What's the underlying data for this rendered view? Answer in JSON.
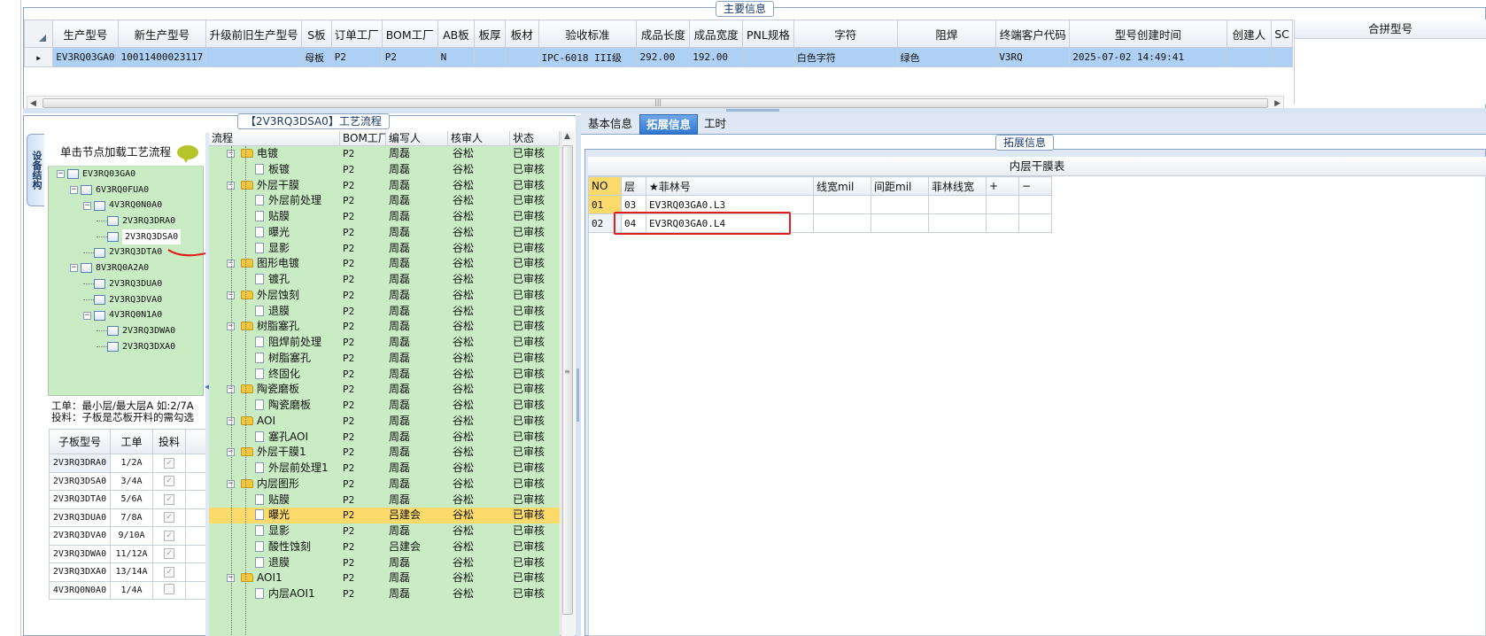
{
  "main_info": {
    "legend": "主要信息",
    "columns": [
      "生产型号",
      "新生产型号",
      "升级前旧生产型号",
      "S板",
      "订单工厂",
      "BOM工厂",
      "AB板",
      "板厚",
      "板材",
      "验收标准",
      "成品长度",
      "成品宽度",
      "PNL规格",
      "字符",
      "阻焊",
      "终端客户代码",
      "型号创建时间",
      "创建人",
      "SC"
    ],
    "rows": [
      [
        "EV3RQ03GA0",
        "10011400023117",
        "",
        "母板",
        "P2",
        "P2",
        "N",
        "",
        "",
        "IPC-6018 III级",
        "292.00",
        "192.00",
        "",
        "白色字符",
        "绿色",
        "V3RQ",
        "2025-07-02 14:49:41",
        "",
        ""
      ]
    ],
    "combo_header": "合拼型号"
  },
  "left": {
    "legend": "【2V3RQ3DSA0】工艺流程",
    "vertical_tab": "设备结构",
    "tree_header": "单击节点加载工艺流程",
    "tree": [
      {
        "label": "EV3RQ03GA0",
        "depth": 0,
        "expander": "−"
      },
      {
        "label": "6V3RQ0FUA0",
        "depth": 1,
        "expander": "−"
      },
      {
        "label": "4V3RQ0N0A0",
        "depth": 2,
        "expander": "−"
      },
      {
        "label": "2V3RQ3DRA0",
        "depth": 3,
        "expander": ""
      },
      {
        "label": "2V3RQ3DSA0",
        "depth": 3,
        "expander": "",
        "selected": true
      },
      {
        "label": "2V3RQ3DTA0",
        "depth": 2,
        "expander": ""
      },
      {
        "label": "8V3RQ0A2A0",
        "depth": 1,
        "expander": "−"
      },
      {
        "label": "2V3RQ3DUA0",
        "depth": 2,
        "expander": ""
      },
      {
        "label": "2V3RQ3DVA0",
        "depth": 2,
        "expander": ""
      },
      {
        "label": "4V3RQ0N1A0",
        "depth": 2,
        "expander": "−"
      },
      {
        "label": "2V3RQ3DWA0",
        "depth": 3,
        "expander": ""
      },
      {
        "label": "2V3RQ3DXA0",
        "depth": 3,
        "expander": ""
      }
    ],
    "note1": "工单：最小层/最大层A 如:2/7A",
    "note2": "投料：子板是芯板开料的需勾选",
    "sub_columns": [
      "子板型号",
      "工单",
      "投料"
    ],
    "sub_rows": [
      [
        "2V3RQ3DRA0",
        "1/2A",
        true
      ],
      [
        "2V3RQ3DSA0",
        "3/4A",
        true
      ],
      [
        "2V3RQ3DTA0",
        "5/6A",
        true
      ],
      [
        "2V3RQ3DUA0",
        "7/8A",
        true
      ],
      [
        "2V3RQ3DVA0",
        "9/10A",
        true
      ],
      [
        "2V3RQ3DWA0",
        "11/12A",
        true
      ],
      [
        "2V3RQ3DXA0",
        "13/14A",
        true
      ],
      [
        "4V3RQ0N0A0",
        "1/4A",
        false
      ]
    ]
  },
  "process": {
    "columns": [
      "流程",
      "BOM工厂",
      "编写人",
      "核审人",
      "状态"
    ],
    "rows": [
      {
        "name": "电镀",
        "type": "folder",
        "bom": "P2",
        "writer": "周磊",
        "reviewer": "谷松",
        "status": "已审核"
      },
      {
        "name": "板镀",
        "type": "doc",
        "bom": "P2",
        "writer": "周磊",
        "reviewer": "谷松",
        "status": "已审核"
      },
      {
        "name": "外层干膜",
        "type": "folder",
        "bom": "P2",
        "writer": "周磊",
        "reviewer": "谷松",
        "status": "已审核"
      },
      {
        "name": "外层前处理",
        "type": "doc",
        "bom": "P2",
        "writer": "周磊",
        "reviewer": "谷松",
        "status": "已审核"
      },
      {
        "name": "贴膜",
        "type": "doc",
        "bom": "P2",
        "writer": "周磊",
        "reviewer": "谷松",
        "status": "已审核"
      },
      {
        "name": "曝光",
        "type": "doc",
        "bom": "P2",
        "writer": "周磊",
        "reviewer": "谷松",
        "status": "已审核"
      },
      {
        "name": "显影",
        "type": "doc",
        "bom": "P2",
        "writer": "周磊",
        "reviewer": "谷松",
        "status": "已审核"
      },
      {
        "name": "图形电镀",
        "type": "folder",
        "bom": "P2",
        "writer": "周磊",
        "reviewer": "谷松",
        "status": "已审核"
      },
      {
        "name": "镀孔",
        "type": "doc",
        "bom": "P2",
        "writer": "周磊",
        "reviewer": "谷松",
        "status": "已审核"
      },
      {
        "name": "外层蚀刻",
        "type": "folder",
        "bom": "P2",
        "writer": "周磊",
        "reviewer": "谷松",
        "status": "已审核"
      },
      {
        "name": "退膜",
        "type": "doc",
        "bom": "P2",
        "writer": "周磊",
        "reviewer": "谷松",
        "status": "已审核"
      },
      {
        "name": "树脂塞孔",
        "type": "folder",
        "bom": "P2",
        "writer": "周磊",
        "reviewer": "谷松",
        "status": "已审核"
      },
      {
        "name": "阻焊前处理",
        "type": "doc",
        "bom": "P2",
        "writer": "周磊",
        "reviewer": "谷松",
        "status": "已审核"
      },
      {
        "name": "树脂塞孔",
        "type": "doc",
        "bom": "P2",
        "writer": "周磊",
        "reviewer": "谷松",
        "status": "已审核"
      },
      {
        "name": "终固化",
        "type": "doc",
        "bom": "P2",
        "writer": "周磊",
        "reviewer": "谷松",
        "status": "已审核"
      },
      {
        "name": "陶瓷磨板",
        "type": "folder",
        "bom": "P2",
        "writer": "周磊",
        "reviewer": "谷松",
        "status": "已审核"
      },
      {
        "name": "陶瓷磨板",
        "type": "doc",
        "bom": "P2",
        "writer": "周磊",
        "reviewer": "谷松",
        "status": "已审核"
      },
      {
        "name": "AOI",
        "type": "folder",
        "bom": "P2",
        "writer": "周磊",
        "reviewer": "谷松",
        "status": "已审核"
      },
      {
        "name": "塞孔AOI",
        "type": "doc",
        "bom": "P2",
        "writer": "周磊",
        "reviewer": "谷松",
        "status": "已审核"
      },
      {
        "name": "外层干膜1",
        "type": "folder",
        "bom": "P2",
        "writer": "周磊",
        "reviewer": "谷松",
        "status": "已审核"
      },
      {
        "name": "外层前处理1",
        "type": "doc",
        "bom": "P2",
        "writer": "周磊",
        "reviewer": "谷松",
        "status": "已审核"
      },
      {
        "name": "内层图形",
        "type": "folder",
        "bom": "P2",
        "writer": "周磊",
        "reviewer": "谷松",
        "status": "已审核"
      },
      {
        "name": "贴膜",
        "type": "doc",
        "bom": "P2",
        "writer": "周磊",
        "reviewer": "谷松",
        "status": "已审核"
      },
      {
        "name": "曝光",
        "type": "doc",
        "bom": "P2",
        "writer": "吕建会",
        "reviewer": "谷松",
        "status": "已审核",
        "highlight": true
      },
      {
        "name": "显影",
        "type": "doc",
        "bom": "P2",
        "writer": "周磊",
        "reviewer": "谷松",
        "status": "已审核"
      },
      {
        "name": "酸性蚀刻",
        "type": "doc",
        "bom": "P2",
        "writer": "吕建会",
        "reviewer": "谷松",
        "status": "已审核"
      },
      {
        "name": "退膜",
        "type": "doc",
        "bom": "P2",
        "writer": "周磊",
        "reviewer": "谷松",
        "status": "已审核"
      },
      {
        "name": "AOI1",
        "type": "folder",
        "bom": "P2",
        "writer": "周磊",
        "reviewer": "谷松",
        "status": "已审核"
      },
      {
        "name": "内层AOI1",
        "type": "doc",
        "bom": "P2",
        "writer": "周磊",
        "reviewer": "谷松",
        "status": "已审核"
      }
    ]
  },
  "right": {
    "tabs": [
      "基本信息",
      "拓展信息",
      "工时"
    ],
    "active_tab": 1,
    "legend": "拓展信息",
    "table_title": "内层干膜表",
    "columns": [
      "NO",
      "层",
      "★菲林号",
      "线宽mil",
      "间距mil",
      "菲林线宽",
      "+",
      "−"
    ],
    "rows": [
      [
        "01",
        "03",
        "EV3RQ03GA0.L3",
        "",
        "",
        "",
        "",
        ""
      ],
      [
        "02",
        "04",
        "EV3RQ03GA0.L4",
        "",
        "",
        "",
        "",
        ""
      ]
    ]
  },
  "colors": {
    "accent": "#2f77d1",
    "tree_bg": "#c9ecc4",
    "highlight": "#fbd96a",
    "selected_row": "#aed0f4",
    "annotation": "#e02020"
  }
}
